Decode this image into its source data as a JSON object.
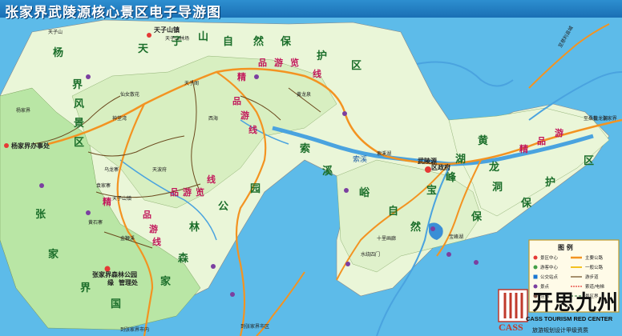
{
  "title": "张家界武陵源核心景区电子导游图",
  "zones": {
    "tianzi": [
      "天",
      "子",
      "山",
      "自",
      "然",
      "保",
      "护",
      "区"
    ],
    "zhangjiajie": [
      "张",
      "家",
      "界",
      "国"
    ],
    "forest": [
      "公",
      "园",
      "林",
      "森",
      "家"
    ],
    "yangjiajie": [
      "杨",
      "界",
      "风",
      "景",
      "区"
    ],
    "suoxi": [
      "索",
      "溪",
      "峪",
      "自",
      "然",
      "保"
    ],
    "suoxi_right": [
      "宝",
      "峰",
      "湖",
      "黄",
      "龙",
      "洞",
      "保",
      "护",
      "区"
    ]
  },
  "routes": {
    "r1": [
      "品",
      "游",
      "览",
      "线"
    ],
    "r2": [
      "精",
      "品",
      "游",
      "线"
    ],
    "r3": [
      "品",
      "游",
      "览",
      "线"
    ],
    "r4": [
      "精",
      "品",
      "游",
      "线"
    ],
    "r5": [
      "精",
      "品",
      "游"
    ]
  },
  "towns": {
    "wulingyuan": "武陵源",
    "wulingyuan2": "区政府",
    "tianzishan": "天子山镇",
    "yangjiajie": "杨家界办事处",
    "forest_park": "张家界森林公园",
    "admin": "管理处",
    "admin_prefix": "缘"
  },
  "places": {
    "p1": "天子山镇",
    "p2": "天子阁",
    "p3": "天子山林场",
    "p4": "仙女散花",
    "p5": "黄龙泉",
    "p6": "西海",
    "p7": "神堂湾",
    "p8": "乌龙寨",
    "p9": "天波府",
    "p10": "袁家寨",
    "p11": "金鞭溪",
    "p12": "黄石寨",
    "p13": "十里画廊",
    "p14": "水绕四门",
    "p15": "宝峰湖",
    "p16": "黄龙洞",
    "p17": "天子山",
    "p18": "杨家界"
  },
  "roads": {
    "r_top": "至慈利县城",
    "r_right": "至桑植 · 张家界",
    "r_bottom1": "到张家界市内",
    "r_bottom2": "到张家界市区",
    "r_mid": "索溪湖"
  },
  "river_label": "索溪",
  "legend": {
    "title": "图 例",
    "items": [
      "景区中心",
      "游客中心",
      "公交站点",
      "景点",
      "住宿",
      "主要公路",
      "一般公路",
      "游步道",
      "索道/电梯",
      "景区界"
    ]
  },
  "brand": {
    "cn": "开思九州",
    "en": "CASS TOURISM RED CENTER",
    "sub": "旅游规划设计甲级资质",
    "logo_text": "CASS"
  },
  "colors": {
    "water": "#5dbbe9",
    "land_green": "#b9e6a5",
    "land_pale": "#eaf6d8",
    "road_orange": "#f39321",
    "trail_brown": "#6b4a1e",
    "route_pink": "#c2185b"
  }
}
